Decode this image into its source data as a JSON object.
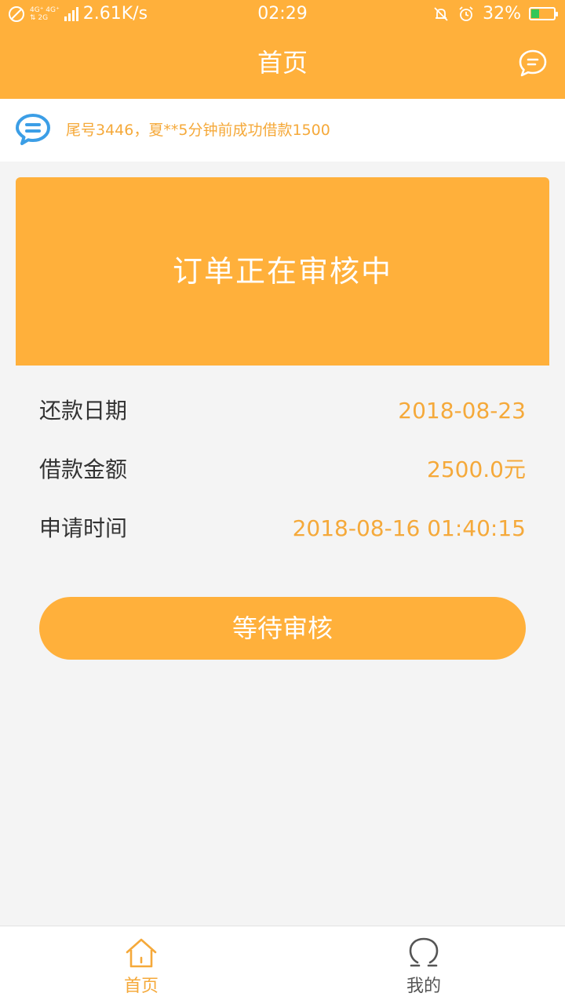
{
  "statusbar": {
    "network_top": "4G⁺ 4G⁺",
    "network_bottom": "⇅ 2G",
    "speed": "2.61K/s",
    "time": "02:29",
    "battery_text": "32%",
    "battery_level": 0.32
  },
  "header": {
    "title": "首页",
    "message_icon": "chat-bubble-icon"
  },
  "notice": {
    "icon": "message-bubble-icon",
    "text": "尾号3446，夏**5分钟前成功借款1500"
  },
  "order": {
    "status_title": "订单正在审核中",
    "rows": [
      {
        "label": "还款日期",
        "value": "2018-08-23"
      },
      {
        "label": "借款金额",
        "value": "2500.0元"
      },
      {
        "label": "申请时间",
        "value": "2018-08-16 01:40:15"
      }
    ],
    "action_label": "等待审核"
  },
  "tabs": [
    {
      "label": "首页",
      "icon": "home-icon",
      "active": true
    },
    {
      "label": "我的",
      "icon": "user-icon",
      "active": false
    }
  ],
  "colors": {
    "accent": "#ffb03b",
    "accent_text": "#f5a93a",
    "notice_icon": "#3b9ee6"
  }
}
